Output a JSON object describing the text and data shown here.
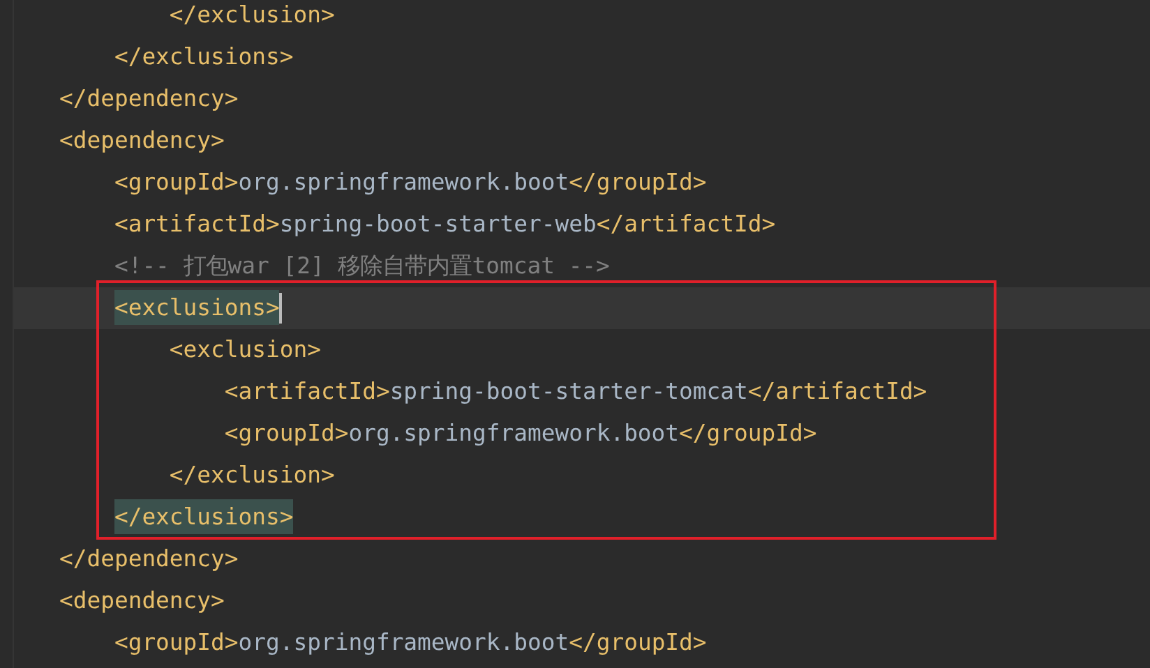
{
  "lines_before": [
    {
      "tokens": [
        {
          "kind": "tag",
          "text": "            </exclusion>",
          "matched": false
        }
      ]
    },
    {
      "tokens": [
        {
          "kind": "tag",
          "text": "        </exclusions>",
          "matched": false
        }
      ]
    },
    {
      "tokens": [
        {
          "kind": "tag",
          "text": "    </dependency>",
          "matched": false
        }
      ]
    },
    {
      "tokens": [
        {
          "kind": "tag",
          "text": "    <dependency>",
          "matched": false
        }
      ]
    },
    {
      "tokens": [
        {
          "kind": "tag",
          "text": "        <groupId>",
          "matched": false
        },
        {
          "kind": "text",
          "text": "org.springframework.boot",
          "matched": false
        },
        {
          "kind": "tag",
          "text": "</groupId>",
          "matched": false
        }
      ]
    },
    {
      "tokens": [
        {
          "kind": "tag",
          "text": "        <artifactId>",
          "matched": false
        },
        {
          "kind": "text",
          "text": "spring-boot-starter-web",
          "matched": false
        },
        {
          "kind": "tag",
          "text": "</artifactId>",
          "matched": false
        }
      ]
    },
    {
      "tokens": [
        {
          "kind": "comment",
          "text": "        <!-- 打包war [2] 移除自带内置tomcat -->",
          "matched": false
        }
      ]
    }
  ],
  "boxed_lines": [
    {
      "caret": true,
      "tokens": [
        {
          "kind": "tag",
          "text": "        <exclusions>",
          "matched": true
        }
      ]
    },
    {
      "caret": false,
      "tokens": [
        {
          "kind": "tag",
          "text": "            <exclusion>",
          "matched": false
        }
      ]
    },
    {
      "caret": false,
      "tokens": [
        {
          "kind": "tag",
          "text": "                <artifactId>",
          "matched": false
        },
        {
          "kind": "text",
          "text": "spring-boot-starter-tomcat",
          "matched": false
        },
        {
          "kind": "tag",
          "text": "</artifactId>",
          "matched": false
        }
      ]
    },
    {
      "caret": false,
      "tokens": [
        {
          "kind": "tag",
          "text": "                <groupId>",
          "matched": false
        },
        {
          "kind": "text",
          "text": "org.springframework.boot",
          "matched": false
        },
        {
          "kind": "tag",
          "text": "</groupId>",
          "matched": false
        }
      ]
    },
    {
      "caret": false,
      "tokens": [
        {
          "kind": "tag",
          "text": "            </exclusion>",
          "matched": false
        }
      ]
    },
    {
      "caret": false,
      "tokens": [
        {
          "kind": "tag",
          "text": "        </exclusions>",
          "matched": true
        }
      ]
    }
  ],
  "lines_after": [
    {
      "tokens": [
        {
          "kind": "tag",
          "text": "    </dependency>",
          "matched": false
        }
      ]
    },
    {
      "tokens": [
        {
          "kind": "tag",
          "text": "    <dependency>",
          "matched": false
        }
      ]
    },
    {
      "tokens": [
        {
          "kind": "tag",
          "text": "        <groupId>",
          "matched": false
        },
        {
          "kind": "text",
          "text": "org.springframework.boot",
          "matched": false
        },
        {
          "kind": "tag",
          "text": "</groupId>",
          "matched": false
        }
      ]
    }
  ]
}
